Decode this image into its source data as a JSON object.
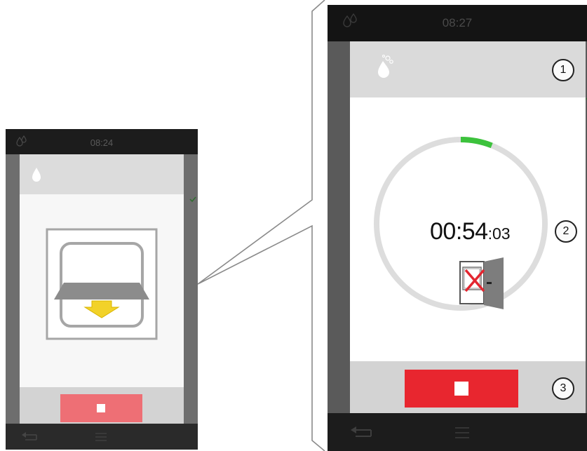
{
  "small_screen": {
    "status_time": "08:24",
    "stop_button_color": "#ee6f75"
  },
  "large_screen": {
    "status_time": "08:27",
    "timer": {
      "main": "00:54",
      "seconds": ":03"
    },
    "timer_progress_fraction": 0.06,
    "progress_color": "#3cc23c",
    "stop_button_color": "#e8262f"
  },
  "callouts": [
    "1",
    "2",
    "3"
  ],
  "icons": {
    "status": "water-drops-icon",
    "header": "water-drop-icon",
    "illustration": "oven-door-lowering-icon",
    "door": "door-open-crossed-icon",
    "stop": "stop-square-icon",
    "back": "back-arrow-icon",
    "menu": "menu-lines-icon"
  }
}
